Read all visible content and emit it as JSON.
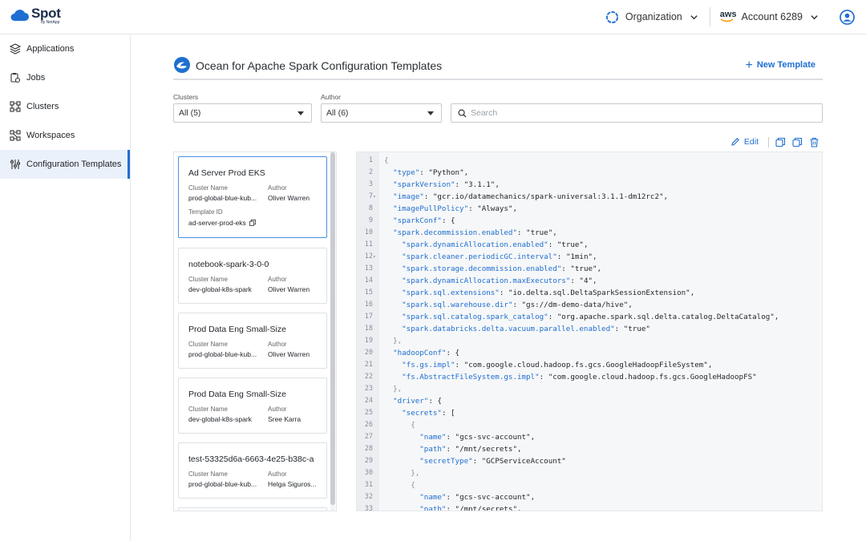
{
  "brand": {
    "name": "Spot",
    "sub": "by NetApp"
  },
  "header": {
    "org_label": "Organization",
    "aws_label": "aws",
    "account_label": "Account 6289"
  },
  "sidebar": {
    "items": [
      {
        "label": "Applications",
        "icon": "layers-icon"
      },
      {
        "label": "Jobs",
        "icon": "jobs-icon"
      },
      {
        "label": "Clusters",
        "icon": "clusters-icon"
      },
      {
        "label": "Workspaces",
        "icon": "workspaces-icon"
      },
      {
        "label": "Configuration Templates",
        "icon": "sliders-icon",
        "active": true
      }
    ]
  },
  "page": {
    "title": "Ocean for Apache Spark Configuration Templates",
    "new_template": "New Template"
  },
  "filters": {
    "clusters_label": "Clusters",
    "clusters_value": "All (5)",
    "author_label": "Author",
    "author_value": "All (6)",
    "search_placeholder": "Search"
  },
  "actions": {
    "edit": "Edit"
  },
  "templates": [
    {
      "title": "Ad Server Prod EKS",
      "cluster_label": "Cluster Name",
      "cluster": "prod-global-blue-kub...",
      "author_label": "Author",
      "author": "Oliver Warren",
      "id_label": "Template ID",
      "id": "ad-server-prod-eks"
    },
    {
      "title": "notebook-spark-3-0-0",
      "cluster_label": "Cluster Name",
      "cluster": "dev-global-k8s-spark",
      "author_label": "Author",
      "author": "Oliver Warren"
    },
    {
      "title": "Prod Data Eng Small-Size",
      "cluster_label": "Cluster Name",
      "cluster": "prod-global-blue-kub...",
      "author_label": "Author",
      "author": "Oliver Warren"
    },
    {
      "title": "Prod Data Eng Small-Size",
      "cluster_label": "Cluster Name",
      "cluster": "dev-global-k8s-spark",
      "author_label": "Author",
      "author": "Sree Karra"
    },
    {
      "title": "test-53325d6a-6663-4e25-b38c-a",
      "cluster_label": "Cluster Name",
      "cluster": "prod-global-blue-kub...",
      "author_label": "Author",
      "author": "Helga Siguros..."
    }
  ],
  "code_lines": [
    {
      "n": "1",
      "fold": false,
      "indent": "",
      "key": "",
      "rest": "{"
    },
    {
      "n": "2",
      "fold": false,
      "indent": "  ",
      "key": "\"type\"",
      "rest": ": \"Python\","
    },
    {
      "n": "3",
      "fold": false,
      "indent": "  ",
      "key": "\"sparkVersion\"",
      "rest": ": \"3.1.1\","
    },
    {
      "n": "7",
      "fold": true,
      "indent": "  ",
      "key": "\"image\"",
      "rest": ": \"gcr.io/datamechanics/spark-universal:3.1.1-dm12rc2\","
    },
    {
      "n": "8",
      "fold": false,
      "indent": "  ",
      "key": "\"imagePullPolicy\"",
      "rest": ": \"Always\","
    },
    {
      "n": "9",
      "fold": false,
      "indent": "  ",
      "key": "\"sparkConf\"",
      "rest": ": {"
    },
    {
      "n": "10",
      "fold": false,
      "indent": "  ",
      "key": "\"spark.decommission.enabled\"",
      "rest": ": \"true\","
    },
    {
      "n": "11",
      "fold": false,
      "indent": "    ",
      "key": "\"spark.dynamicAllocation.enabled\"",
      "rest": ": \"true\","
    },
    {
      "n": "12",
      "fold": true,
      "indent": "    ",
      "key": "\"spark.cleaner.periodicGC.interval\"",
      "rest": ": \"1min\","
    },
    {
      "n": "13",
      "fold": false,
      "indent": "    ",
      "key": "\"spark.storage.decommission.enabled\"",
      "rest": ": \"true\","
    },
    {
      "n": "14",
      "fold": false,
      "indent": "    ",
      "key": "\"spark.dynamicAllocation.maxExecutors\"",
      "rest": ": \"4\","
    },
    {
      "n": "15",
      "fold": false,
      "indent": "    ",
      "key": "\"spark.sql.extensions\"",
      "rest": ": \"io.delta.sql.DeltaSparkSessionExtension\","
    },
    {
      "n": "16",
      "fold": false,
      "indent": "    ",
      "key": "\"spark.sql.warehouse.dir\"",
      "rest": ": \"gs://dm-demo-data/hive\","
    },
    {
      "n": "17",
      "fold": false,
      "indent": "    ",
      "key": "\"spark.sql.catalog.spark_catalog\"",
      "rest": ": \"org.apache.spark.sql.delta.catalog.DeltaCatalog\","
    },
    {
      "n": "18",
      "fold": false,
      "indent": "    ",
      "key": "\"spark.databricks.delta.vacuum.parallel.enabled\"",
      "rest": ": \"true\""
    },
    {
      "n": "19",
      "fold": false,
      "indent": "  ",
      "key": "",
      "rest": "},"
    },
    {
      "n": "20",
      "fold": false,
      "indent": "  ",
      "key": "\"hadoopConf\"",
      "rest": ": {"
    },
    {
      "n": "21",
      "fold": false,
      "indent": "    ",
      "key": "\"fs.gs.impl\"",
      "rest": ": \"com.google.cloud.hadoop.fs.gcs.GoogleHadoopFileSystem\","
    },
    {
      "n": "22",
      "fold": false,
      "indent": "    ",
      "key": "\"fs.AbstractFileSystem.gs.impl\"",
      "rest": ": \"com.google.cloud.hadoop.fs.gcs.GoogleHadoopFS\""
    },
    {
      "n": "23",
      "fold": false,
      "indent": "  ",
      "key": "",
      "rest": "},"
    },
    {
      "n": "24",
      "fold": false,
      "indent": "  ",
      "key": "\"driver\"",
      "rest": ": {"
    },
    {
      "n": "25",
      "fold": false,
      "indent": "    ",
      "key": "\"secrets\"",
      "rest": ": ["
    },
    {
      "n": "26",
      "fold": false,
      "indent": "      ",
      "key": "",
      "rest": "{"
    },
    {
      "n": "27",
      "fold": false,
      "indent": "        ",
      "key": "\"name\"",
      "rest": ": \"gcs-svc-account\","
    },
    {
      "n": "28",
      "fold": false,
      "indent": "        ",
      "key": "\"path\"",
      "rest": ": \"/mnt/secrets\","
    },
    {
      "n": "29",
      "fold": false,
      "indent": "        ",
      "key": "\"secretType\"",
      "rest": ": \"GCPServiceAccount\""
    },
    {
      "n": "30",
      "fold": false,
      "indent": "      ",
      "key": "",
      "rest": "},"
    },
    {
      "n": "31",
      "fold": false,
      "indent": "      ",
      "key": "",
      "rest": "{"
    },
    {
      "n": "32",
      "fold": false,
      "indent": "        ",
      "key": "\"name\"",
      "rest": ": \"gcs-svc-account\","
    },
    {
      "n": "33",
      "fold": false,
      "indent": "        ",
      "key": "\"path\"",
      "rest": ": \"/mnt/secrets\","
    }
  ],
  "colors": {
    "accent": "#1f6fd1",
    "key": "#1f6fd1",
    "brand": "#1a2b4a"
  }
}
